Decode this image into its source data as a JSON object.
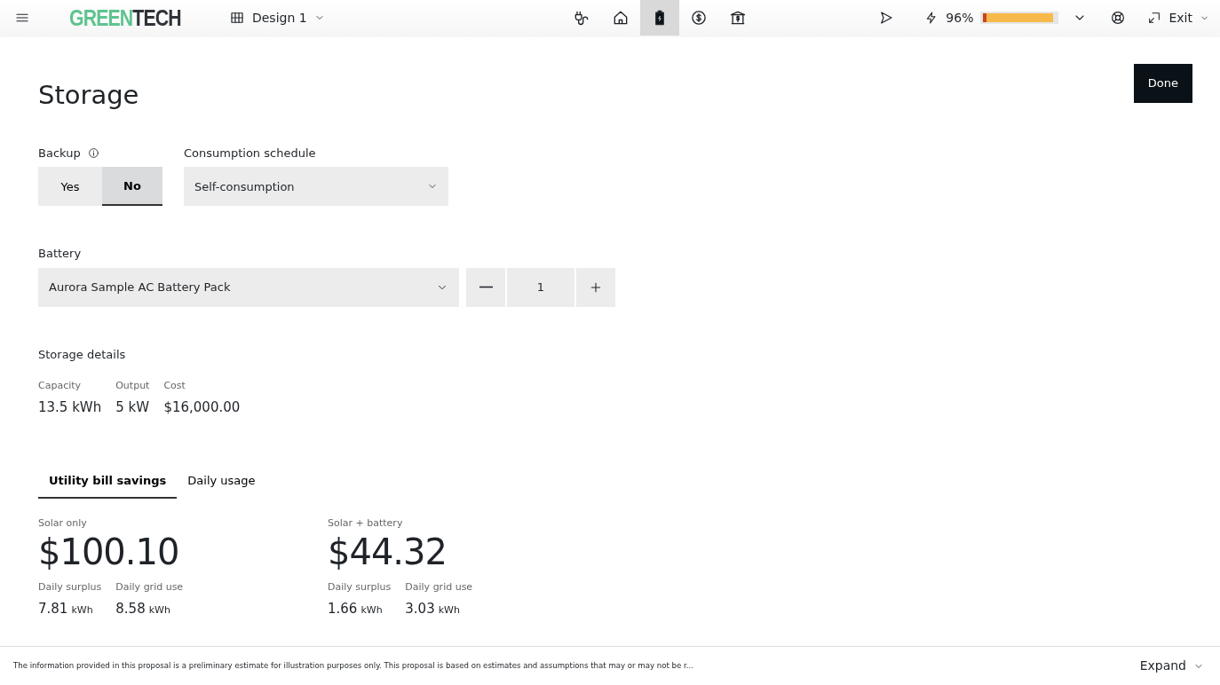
{
  "header": {
    "logo": {
      "part_1": "GREEN",
      "part_2": "TECH"
    },
    "design": "Design 1",
    "nav": [
      {
        "kind": "plug",
        "selected": false
      },
      {
        "kind": "home",
        "selected": false
      },
      {
        "kind": "battery",
        "selected": true
      },
      {
        "kind": "dollar",
        "selected": false
      },
      {
        "kind": "bank",
        "selected": false
      }
    ],
    "percent": "96%",
    "meter": {
      "level": 0.96
    },
    "exit": "Exit"
  },
  "title": "Storage",
  "done": "Done",
  "backup": {
    "label": "Backup",
    "options": [
      {
        "label": "Yes",
        "selected": false
      },
      {
        "label": "No",
        "selected": true
      }
    ]
  },
  "schedule": {
    "label": "Consumption schedule",
    "value": "Self-consumption"
  },
  "battery": {
    "label": "Battery",
    "value": "Aurora Sample AC Battery Pack",
    "quantity": "1"
  },
  "details": {
    "title": "Storage details",
    "items": [
      {
        "label": "Capacity",
        "value": "13.5 kWh"
      },
      {
        "label": "Output",
        "value": "5 kW"
      },
      {
        "label": "Cost",
        "value": "$16,000.00"
      }
    ]
  },
  "tabs": [
    {
      "label": "Utility bill savings",
      "selected": true
    },
    {
      "label": "Daily usage",
      "selected": false
    }
  ],
  "savings": [
    {
      "label": "Solar only",
      "amount": "$100.10",
      "stats": [
        {
          "label": "Daily surplus",
          "value": "7.81",
          "unit": "kWh"
        },
        {
          "label": "Daily grid use",
          "value": "8.58",
          "unit": "kWh"
        }
      ]
    },
    {
      "label": "Solar + battery",
      "amount": "$44.32",
      "stats": [
        {
          "label": "Daily surplus",
          "value": "1.66",
          "unit": "kWh"
        },
        {
          "label": "Daily grid use",
          "value": "3.03",
          "unit": "kWh"
        }
      ]
    }
  ],
  "footer": {
    "disclaimer": "The information provided in this proposal is a preliminary estimate for illustration purposes only. This proposal is based on estimates and assumptions that may or may not be r...",
    "expand": "Expand"
  }
}
